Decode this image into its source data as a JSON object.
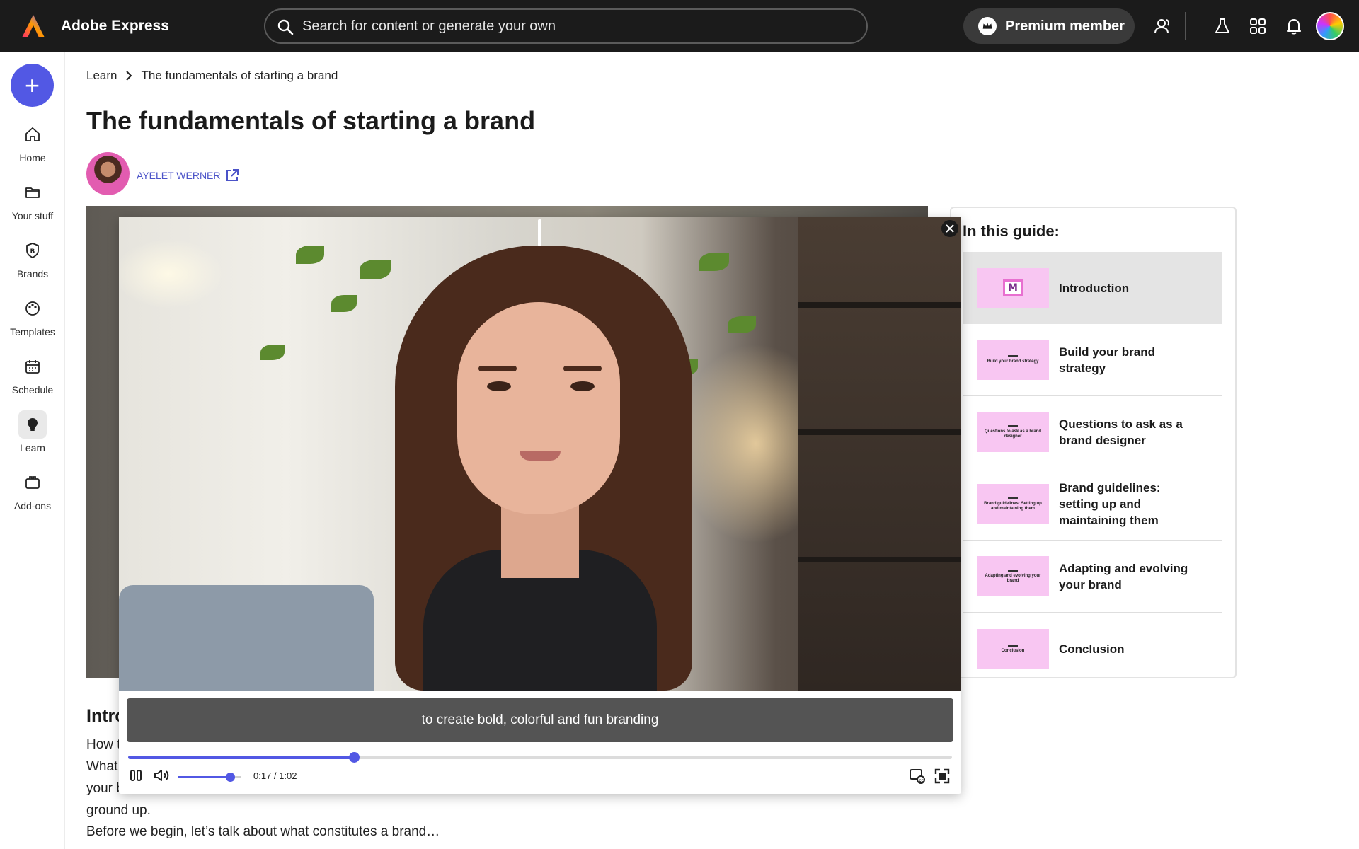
{
  "app": {
    "name": "Adobe Express"
  },
  "search": {
    "placeholder": "Search for content or generate your own"
  },
  "header": {
    "premium_label": "Premium member"
  },
  "rail": {
    "create_label": "+",
    "items": [
      {
        "label": "Home",
        "icon": "home-icon"
      },
      {
        "label": "Your stuff",
        "icon": "folder-icon"
      },
      {
        "label": "Brands",
        "icon": "brand-icon"
      },
      {
        "label": "Templates",
        "icon": "templates-icon"
      },
      {
        "label": "Schedule",
        "icon": "calendar-icon"
      },
      {
        "label": "Learn",
        "icon": "lightbulb-icon",
        "active": true
      },
      {
        "label": "Add-ons",
        "icon": "addons-icon"
      }
    ]
  },
  "breadcrumb": {
    "root": "Learn",
    "current": "The fundamentals of starting a brand"
  },
  "article": {
    "title": "The fundamentals of starting a brand",
    "author": "AYELET WERNER",
    "intro_heading": "Intro",
    "lines": [
      "How t",
      "What",
      "your b",
      "ground up.",
      "Before we begin, let’s talk about what constitutes a brand…"
    ]
  },
  "guide": {
    "title": "In this guide:",
    "items": [
      {
        "label": "Introduction",
        "thumb": "M",
        "active": true
      },
      {
        "label": "Build your brand strategy",
        "thumb": "Build your brand strategy"
      },
      {
        "label": "Questions to ask as a brand designer",
        "thumb": "Questions to ask as a brand designer"
      },
      {
        "label": "Brand guidelines: setting up and maintaining them",
        "thumb": "Brand guidelines: Setting up and maintaining them"
      },
      {
        "label": "Adapting and evolving your brand",
        "thumb": "Adapting and evolving your brand"
      },
      {
        "label": "Conclusion",
        "thumb": "Conclusion"
      }
    ]
  },
  "player": {
    "caption": "to create bold, colorful and fun branding",
    "current_time": "0:17",
    "duration": "1:02",
    "time_display": "0:17 / 1:02",
    "progress_fraction": 0.2742,
    "volume_fraction": 0.82
  },
  "colors": {
    "accent": "#5258e4",
    "topbar": "#1b1b1b",
    "thumb_pink": "#f8c6f2"
  }
}
